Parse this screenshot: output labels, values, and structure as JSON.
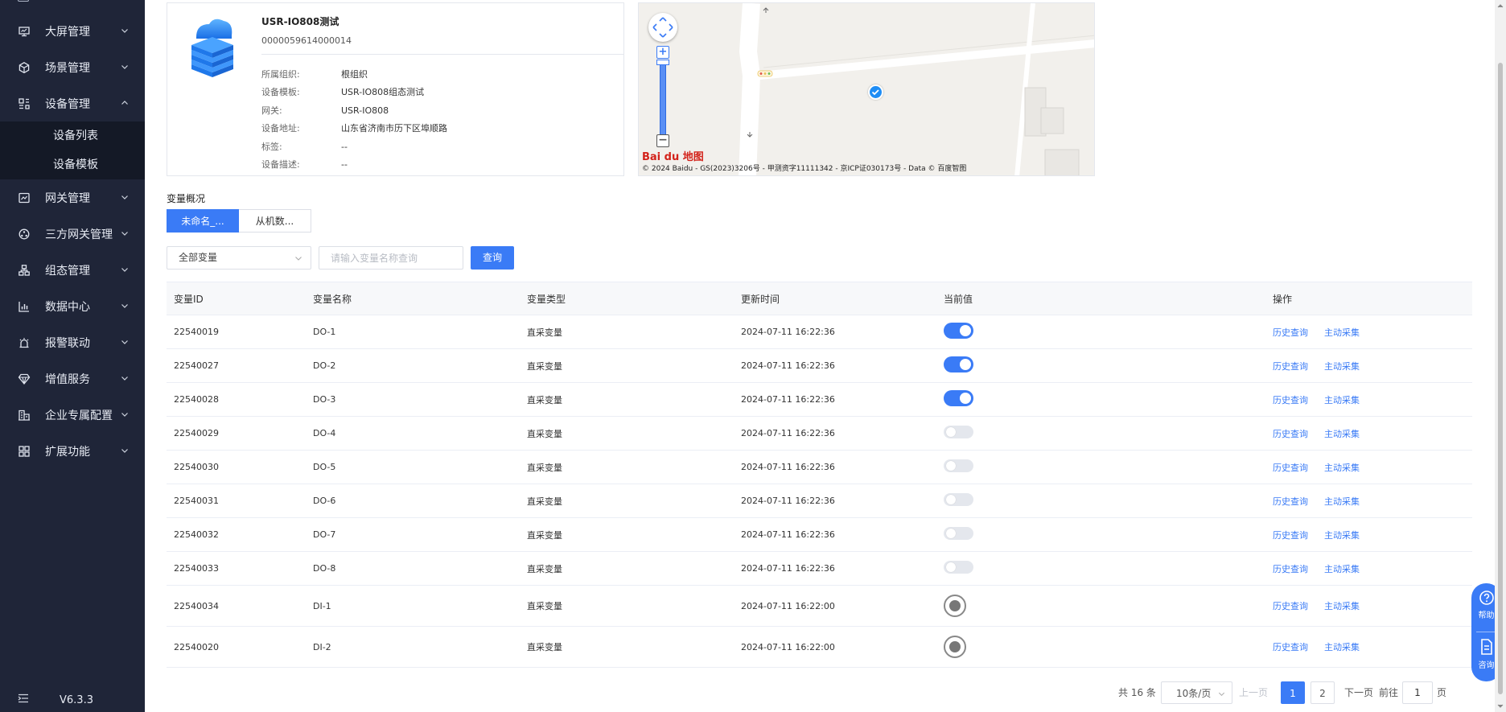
{
  "sidebar": {
    "items": [
      {
        "label": "大屏管理",
        "icon": "monitor-icon"
      },
      {
        "label": "场景管理",
        "icon": "cube-icon"
      },
      {
        "label": "设备管理",
        "icon": "device-icon",
        "expanded": true,
        "children": [
          "设备列表",
          "设备模板"
        ]
      },
      {
        "label": "网关管理",
        "icon": "gateway-icon"
      },
      {
        "label": "三方网关管理",
        "icon": "third-party-icon"
      },
      {
        "label": "组态管理",
        "icon": "topology-icon"
      },
      {
        "label": "数据中心",
        "icon": "bar-chart-icon"
      },
      {
        "label": "报警联动",
        "icon": "alarm-icon"
      },
      {
        "label": "增值服务",
        "icon": "diamond-icon"
      },
      {
        "label": "企业专属配置",
        "icon": "building-icon"
      },
      {
        "label": "扩展功能",
        "icon": "grid-icon"
      }
    ],
    "version": "V6.3.3"
  },
  "device": {
    "name": "USR-IO808测试",
    "id": "0000059614000014",
    "attrs": [
      {
        "key": "所属组织:",
        "value": "根组织"
      },
      {
        "key": "设备模板:",
        "value": "USR-IO808组态测试"
      },
      {
        "key": "网关:",
        "value": "USR-IO808"
      },
      {
        "key": "设备地址:",
        "value": "山东省济南市历下区埠顺路"
      },
      {
        "key": "标签:",
        "value": "--"
      },
      {
        "key": "设备描述:",
        "value": "--"
      }
    ]
  },
  "map": {
    "copyright": "© 2024 Baidu - GS(2023)3206号 - 甲测资字11111342 - 京ICP证030173号 - Data © 百度智图",
    "logo": "Bai du 地图"
  },
  "variables": {
    "section_title": "变量概况",
    "tabs": [
      "未命名_...",
      "从机数..."
    ],
    "filter_value": "全部变量",
    "search_placeholder": "请输入变量名称查询",
    "query_label": "查询",
    "columns": [
      "变量ID",
      "变量名称",
      "变量类型",
      "更新时间",
      "当前值",
      "操作"
    ],
    "ops": [
      "历史查询",
      "主动采集"
    ],
    "rows": [
      {
        "id": "22540019",
        "name": "DO-1",
        "type": "直采变量",
        "time": "2024-07-11 16:22:36",
        "value": "on"
      },
      {
        "id": "22540027",
        "name": "DO-2",
        "type": "直采变量",
        "time": "2024-07-11 16:22:36",
        "value": "on"
      },
      {
        "id": "22540028",
        "name": "DO-3",
        "type": "直采变量",
        "time": "2024-07-11 16:22:36",
        "value": "on"
      },
      {
        "id": "22540029",
        "name": "DO-4",
        "type": "直采变量",
        "time": "2024-07-11 16:22:36",
        "value": "off"
      },
      {
        "id": "22540030",
        "name": "DO-5",
        "type": "直采变量",
        "time": "2024-07-11 16:22:36",
        "value": "off"
      },
      {
        "id": "22540031",
        "name": "DO-6",
        "type": "直采变量",
        "time": "2024-07-11 16:22:36",
        "value": "off"
      },
      {
        "id": "22540032",
        "name": "DO-7",
        "type": "直采变量",
        "time": "2024-07-11 16:22:36",
        "value": "off"
      },
      {
        "id": "22540033",
        "name": "DO-8",
        "type": "直采变量",
        "time": "2024-07-11 16:22:36",
        "value": "off"
      },
      {
        "id": "22540034",
        "name": "DI-1",
        "type": "直采变量",
        "time": "2024-07-11 16:22:00",
        "value": "radio"
      },
      {
        "id": "22540020",
        "name": "DI-2",
        "type": "直采变量",
        "time": "2024-07-11 16:22:00",
        "value": "radio"
      }
    ]
  },
  "pagination": {
    "total": "共 16 条",
    "page_size": "10条/页",
    "prev": "上一页",
    "pages": [
      "1",
      "2"
    ],
    "current": "1",
    "next": "下一页",
    "goto": "前往",
    "goto_value": "1",
    "page_unit": "页"
  },
  "float_help": {
    "help": "帮助",
    "consult": "咨询"
  },
  "colors": {
    "accent": "#3a7bf6",
    "sidebar": "#1f2538"
  }
}
